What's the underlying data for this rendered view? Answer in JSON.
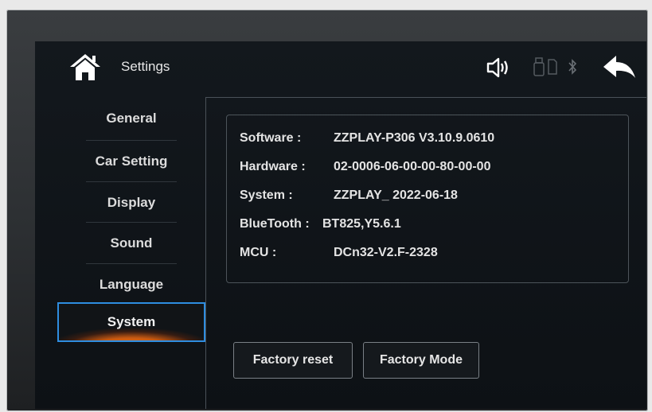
{
  "header": {
    "title": "Settings",
    "icons": [
      "home-icon",
      "speaker-icon",
      "usb-icon",
      "sd-card-icon",
      "bluetooth-icon",
      "back-arrow-icon"
    ]
  },
  "sidebar": {
    "items": [
      {
        "label": "General"
      },
      {
        "label": "Car Setting"
      },
      {
        "label": "Display"
      },
      {
        "label": "Sound"
      },
      {
        "label": "Language"
      },
      {
        "label": "System",
        "active": true
      }
    ]
  },
  "info": {
    "rows": [
      {
        "label": "Software :",
        "value": "ZZPLAY-P306 V3.10.9.0610"
      },
      {
        "label": "Hardware :",
        "value": "02-0006-06-00-00-80-00-00"
      },
      {
        "label": "System :",
        "value": "ZZPLAY_ 2022-06-18"
      },
      {
        "label": "BlueTooth :",
        "value": "BT825,Y5.6.1"
      },
      {
        "label": "MCU :",
        "value": "DCn32-V2.F-2328"
      }
    ]
  },
  "buttons": {
    "factory_reset": "Factory reset",
    "factory_mode": "Factory Mode"
  },
  "colors": {
    "accent_border": "#2e8de0",
    "active_glow": "#ef7a1d",
    "text": "#e4e4e4",
    "screen_bg": "#13181d"
  }
}
